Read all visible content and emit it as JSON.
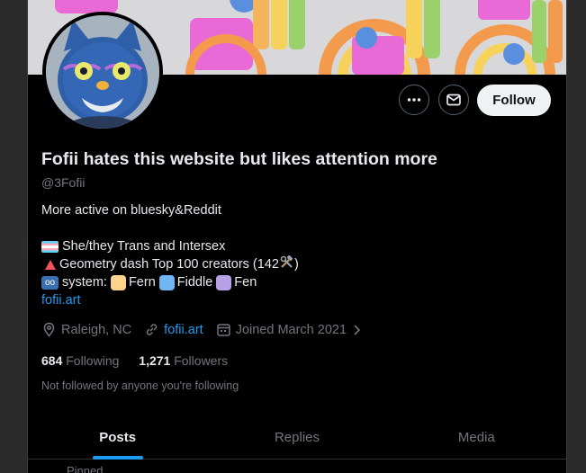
{
  "profile": {
    "display_name": "Fofii hates this website but likes attention more",
    "handle": "@3Fofii",
    "bio_line1": "More active on bluesky&Reddit",
    "bio_line2": "She/they Trans and Intersex",
    "bio_line3_prefix": "Geometry dash Top 100 creators (142",
    "bio_line3_suffix": ")",
    "bio_line4_prefix": "system:",
    "bio_line4_name1": "Fern",
    "bio_line4_name2": "Fiddle",
    "bio_line4_name3": "Fen",
    "bio_link": "fofii.art",
    "location": "Raleigh, NC",
    "website": "fofii.art",
    "joined": "Joined March 2021",
    "following_count": "684",
    "following_label": "Following",
    "followers_count": "1,271",
    "followers_label": "Followers",
    "followed_by_note": "Not followed by anyone you're following"
  },
  "actions": {
    "more_icon": "more-horizontal-icon",
    "message_icon": "envelope-icon",
    "follow_label": "Follow"
  },
  "tabs": [
    {
      "label": "Posts",
      "active": true
    },
    {
      "label": "Replies",
      "active": false
    },
    {
      "label": "Media",
      "active": false
    }
  ],
  "pinned_label": "Pinned",
  "colors": {
    "accent": "#1d9bf0",
    "background": "#000000",
    "muted_text": "#71767b",
    "square_yellow": "#fbd38d",
    "square_blue": "#6fb6f2",
    "square_purple": "#b7a2e8"
  }
}
